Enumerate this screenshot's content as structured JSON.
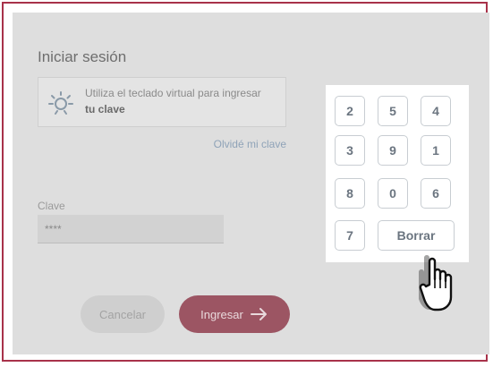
{
  "login": {
    "title": "Iniciar sesión",
    "info_line1": "Utiliza el teclado virtual para ingresar",
    "info_line2": "tu clave",
    "forgot_link": "Olvidé mi clave",
    "password_label": "Clave",
    "password_value": "****",
    "cancel_button": "Cancelar",
    "enter_button": "Ingresar"
  },
  "keypad": {
    "keys": [
      "2",
      "5",
      "4",
      "3",
      "9",
      "1",
      "8",
      "0",
      "6",
      "7"
    ],
    "delete_label": "Borrar"
  },
  "icons": {
    "info": "lightbulb-icon",
    "enter": "arrow-right-icon",
    "cursor": "pointer-hand-icon"
  },
  "colors": {
    "frame_border": "#a8324a",
    "enter_button": "#9c5563",
    "link": "#8fa3b8"
  }
}
